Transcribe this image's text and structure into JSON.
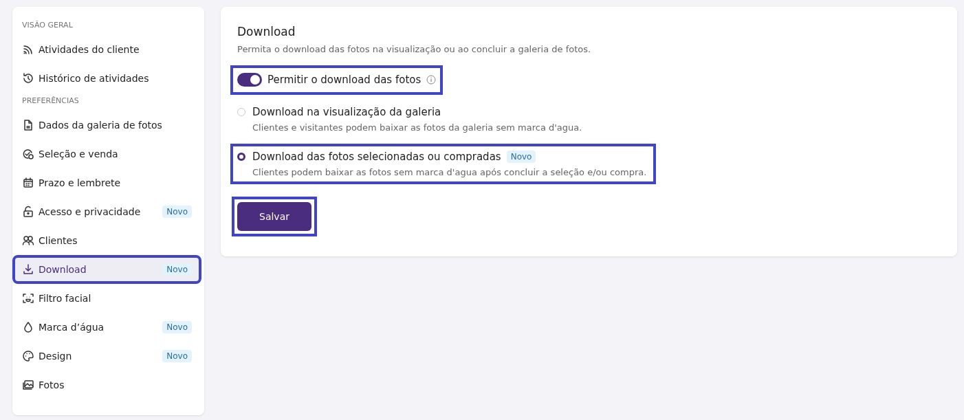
{
  "sidebar": {
    "sections": [
      {
        "heading": "VISÃO GERAL",
        "items": [
          {
            "kind": "rss",
            "label": "Atividades do cliente",
            "selected": false,
            "highlighted": false
          },
          {
            "kind": "history",
            "label": "Histórico de atividades",
            "selected": false,
            "highlighted": false
          }
        ]
      },
      {
        "heading": "PREFERÊNCIAS",
        "items": [
          {
            "kind": "file",
            "label": "Dados da galeria de fotos",
            "selected": false,
            "highlighted": false
          },
          {
            "kind": "check-coin",
            "label": "Seleção e venda",
            "selected": false,
            "highlighted": false
          },
          {
            "kind": "calendar",
            "label": "Prazo e lembrete",
            "selected": false,
            "highlighted": false
          },
          {
            "kind": "lock",
            "label": "Acesso e privacidade",
            "badge": "Novo",
            "selected": false,
            "highlighted": false
          },
          {
            "kind": "users",
            "label": "Clientes",
            "selected": false,
            "highlighted": false
          },
          {
            "kind": "download",
            "label": "Download",
            "badge": "Novo",
            "selected": true,
            "highlighted": true
          },
          {
            "kind": "face",
            "label": "Filtro facial",
            "selected": false,
            "highlighted": false
          },
          {
            "kind": "drop",
            "label": "Marca d’água",
            "badge": "Novo",
            "selected": false,
            "highlighted": false
          },
          {
            "kind": "palette",
            "label": "Design",
            "badge": "Novo",
            "selected": false,
            "highlighted": false
          },
          {
            "kind": "images",
            "label": "Fotos",
            "selected": false,
            "highlighted": false
          }
        ]
      }
    ]
  },
  "panel": {
    "title": "Download",
    "description": "Permita o download das fotos na visualização ou ao concluir a galeria de fotos.",
    "toggle": {
      "label": "Permitir o download das fotos",
      "on": true,
      "highlighted": true
    },
    "options": [
      {
        "label": "Download na visualização da galeria",
        "description": "Clientes e visitantes podem baixar as fotos da galeria sem marca d'agua.",
        "selected": false,
        "highlighted": false
      },
      {
        "label": "Download das fotos selecionadas ou compradas",
        "badge": "Novo",
        "description": "Clientes podem baixar as fotos sem marca d'agua após concluir a seleção e/ou compra.",
        "selected": true,
        "highlighted": true
      }
    ],
    "save": {
      "label": "Salvar",
      "highlighted": true
    }
  }
}
